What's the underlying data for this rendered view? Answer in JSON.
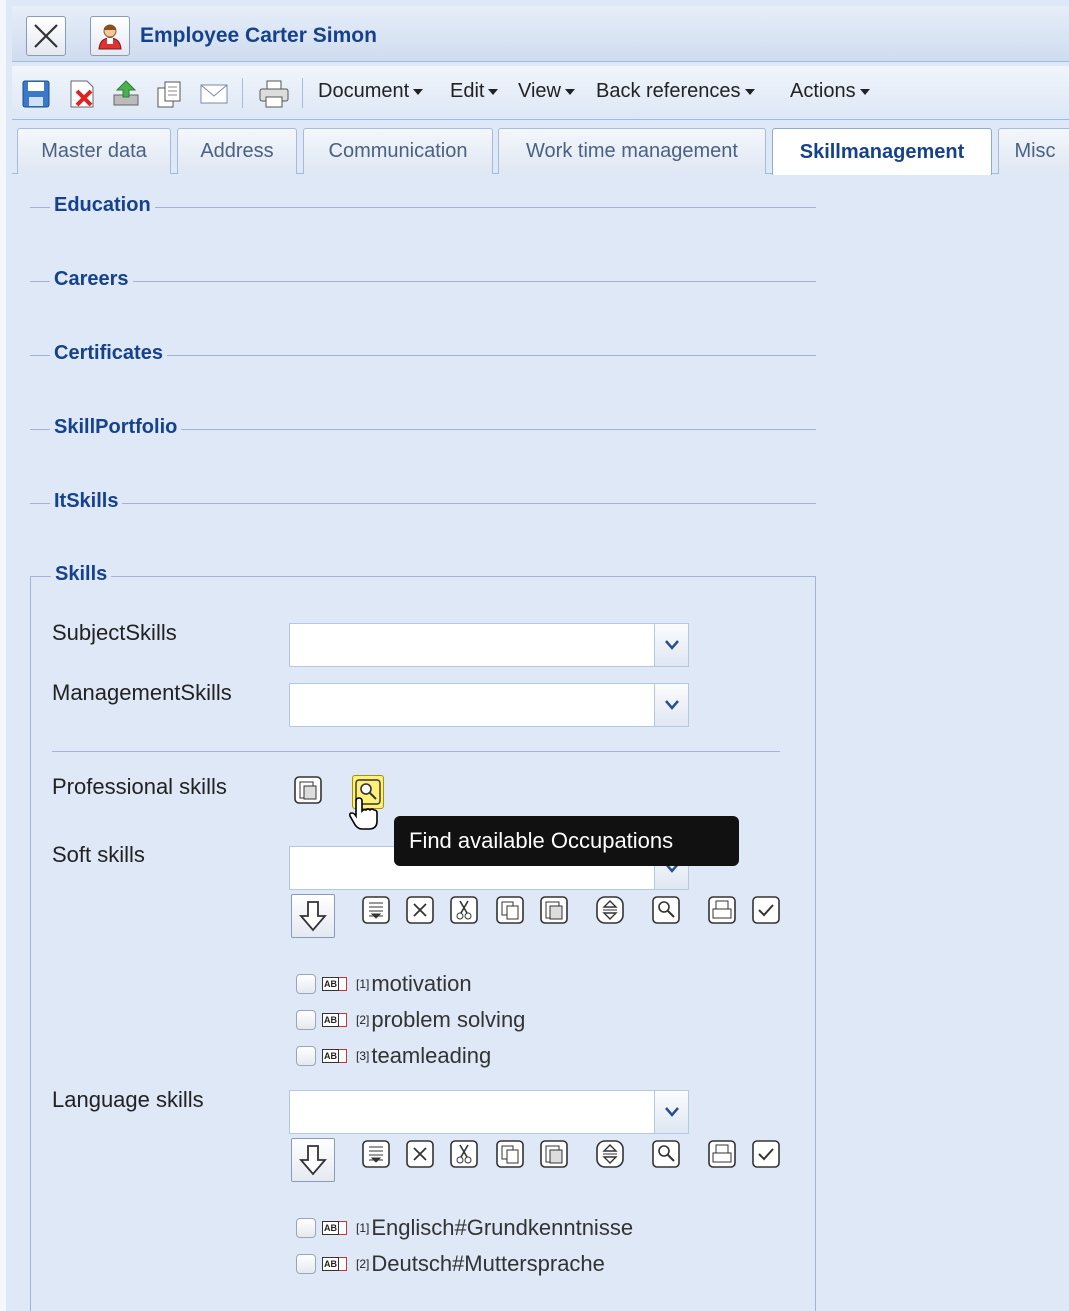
{
  "window": {
    "title": "Employee Carter Simon"
  },
  "toolbar": {
    "menus": [
      "Document",
      "Edit",
      "View",
      "Back references",
      "Actions"
    ]
  },
  "tabs": [
    {
      "label": "Master data",
      "active": false
    },
    {
      "label": "Address",
      "active": false
    },
    {
      "label": "Communication",
      "active": false
    },
    {
      "label": "Work time management",
      "active": false
    },
    {
      "label": "Skillmanagement",
      "active": true
    },
    {
      "label": "Misc",
      "active": false
    }
  ],
  "sections": {
    "education": "Education",
    "careers": "Careers",
    "certificates": "Certificates",
    "skill_portfolio": "SkillPortfolio",
    "it_skills": "ItSkills",
    "skills": "Skills"
  },
  "skills": {
    "subject_label": "SubjectSkills",
    "subject_value": "",
    "management_label": "ManagementSkills",
    "management_value": "",
    "professional_label": "Professional skills",
    "soft_label": "Soft skills",
    "soft_value": "",
    "soft_items": [
      {
        "index": "[1]",
        "text": "motivation"
      },
      {
        "index": "[2]",
        "text": "problem solving"
      },
      {
        "index": "[3]",
        "text": "teamleading"
      }
    ],
    "language_label": "Language skills",
    "language_value": "",
    "language_items": [
      {
        "index": "[1]",
        "text": "Englisch#Grundkenntnisse"
      },
      {
        "index": "[2]",
        "text": "Deutsch#Muttersprache"
      }
    ]
  },
  "tooltip": {
    "text": "Find available Occupations"
  },
  "colors": {
    "accent": "#15428b",
    "panel": "#dfe8f6",
    "border": "#99bbe8"
  }
}
